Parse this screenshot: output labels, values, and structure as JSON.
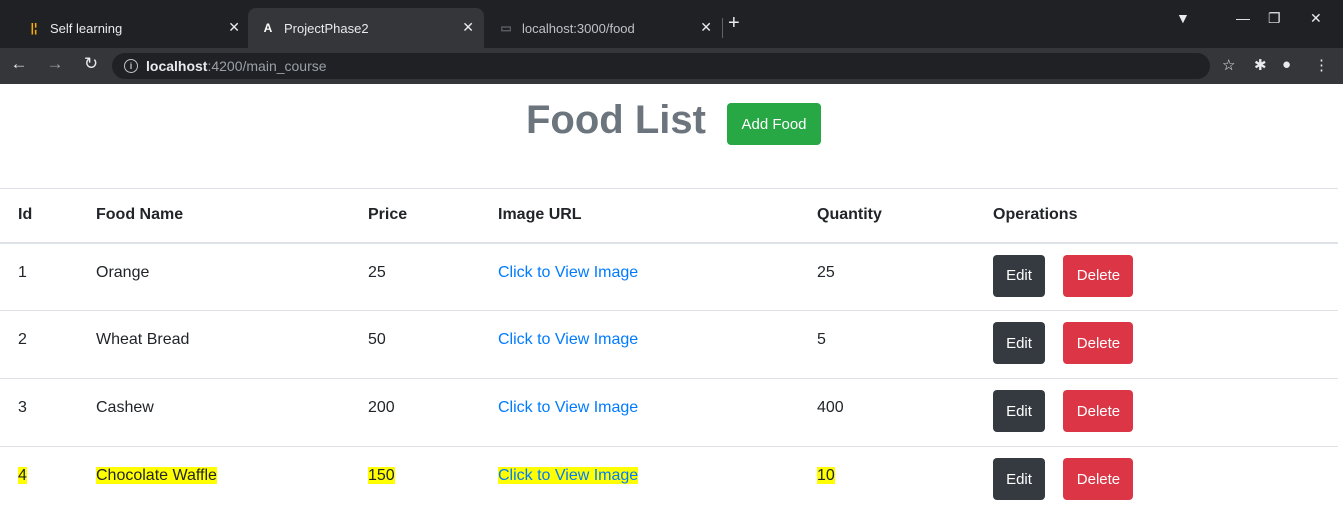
{
  "browser": {
    "tabs": [
      {
        "title": "Self learning",
        "icon": "bar-chart-icon"
      },
      {
        "title": "ProjectPhase2",
        "icon": "angular-icon"
      },
      {
        "title": "localhost:3000/food",
        "icon": "page-icon"
      }
    ],
    "url_host": "localhost",
    "url_path": ":4200/main_course"
  },
  "page": {
    "title": "Food List",
    "add_label": "Add Food"
  },
  "table": {
    "headers": [
      "Id",
      "Food Name",
      "Price",
      "Image URL",
      "Quantity",
      "Operations"
    ],
    "rows": [
      {
        "id": "1",
        "name": "Orange",
        "price": "25",
        "image": "Click to View Image",
        "qty": "25"
      },
      {
        "id": "2",
        "name": "Wheat Bread",
        "price": "50",
        "image": "Click to View Image",
        "qty": "5"
      },
      {
        "id": "3",
        "name": "Cashew",
        "price": "200",
        "image": "Click to View Image",
        "qty": "400"
      },
      {
        "id": "4",
        "name": "Chocolate Waffle",
        "price": "150",
        "image": "Click to View Image",
        "qty": "10"
      }
    ],
    "edit_label": "Edit",
    "delete_label": "Delete"
  },
  "colors": {
    "add": "#28a745",
    "edit": "#343a40",
    "delete": "#dc3545",
    "link": "#007bff",
    "highlight": "#ffff00"
  }
}
